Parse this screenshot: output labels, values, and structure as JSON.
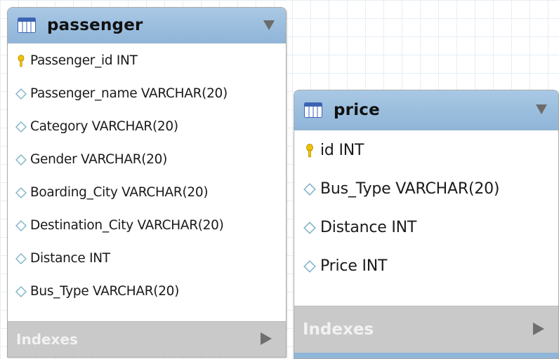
{
  "entities": {
    "passenger": {
      "title": "passenger",
      "columns": [
        {
          "label": "Passenger_id INT",
          "key": "primary"
        },
        {
          "label": "Passenger_name VARCHAR(20)",
          "key": "none"
        },
        {
          "label": "Category VARCHAR(20)",
          "key": "none"
        },
        {
          "label": "Gender VARCHAR(20)",
          "key": "none"
        },
        {
          "label": "Boarding_City VARCHAR(20)",
          "key": "none"
        },
        {
          "label": "Destination_City VARCHAR(20)",
          "key": "none"
        },
        {
          "label": "Distance INT",
          "key": "none"
        },
        {
          "label": "Bus_Type VARCHAR(20)",
          "key": "none"
        }
      ],
      "indexes_label": "Indexes"
    },
    "price": {
      "title": "price",
      "columns": [
        {
          "label": "id INT",
          "key": "primary"
        },
        {
          "label": "Bus_Type VARCHAR(20)",
          "key": "none"
        },
        {
          "label": "Distance INT",
          "key": "none"
        },
        {
          "label": "Price INT",
          "key": "none"
        }
      ],
      "indexes_label": "Indexes"
    }
  },
  "icons": {
    "table": "table-icon",
    "primary_key": "key-icon",
    "column": "diamond-icon",
    "collapse": "triangle-down-icon",
    "expand": "triangle-right-icon"
  },
  "colors": {
    "header": "#a9c8e4",
    "indexes_bar": "#c9c9c9",
    "key": "#f2c200",
    "diamond": "#7fb3c8"
  }
}
